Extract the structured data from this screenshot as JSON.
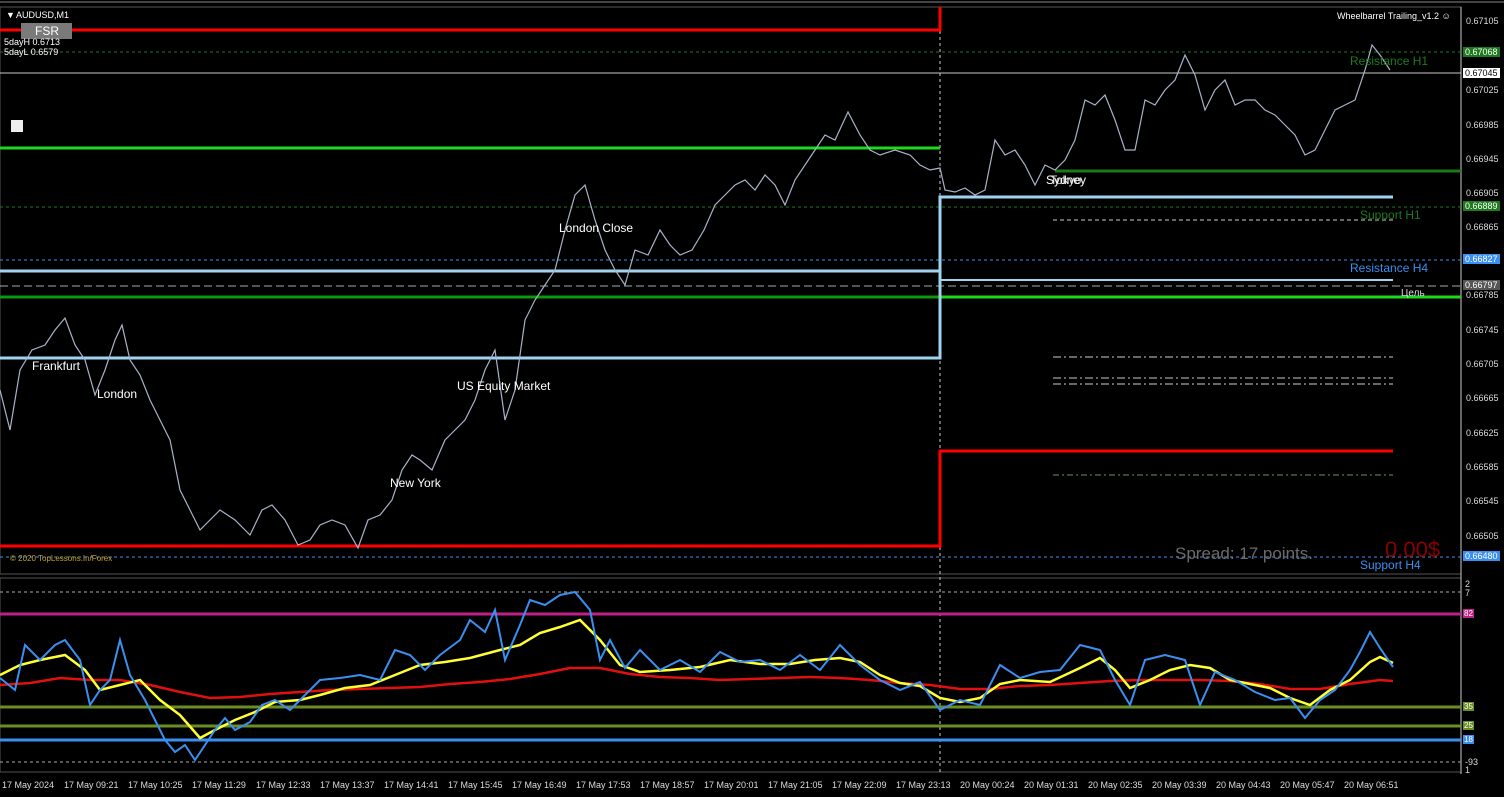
{
  "header": {
    "symbol": "AUDUSD,M1",
    "fsr_button": "FSR",
    "five_day_high": "5dayH 0.6713",
    "five_day_low": "5dayL 0.6579",
    "indicator_name": "Wheelbarrel Trailing_v1.2 ☺"
  },
  "sessions": {
    "frankfurt": "Frankfurt",
    "london": "London",
    "us_equity": "US Equity Market",
    "new_york": "New York",
    "london_close": "London Close",
    "sydney": "Sydney",
    "tokyo": "Tokyo"
  },
  "levels": {
    "resistance_h1": "Resistance H1",
    "support_h1": "Support H1",
    "resistance_h4": "Resistance H4",
    "support_h4": "Support H4",
    "target": "Цель"
  },
  "price_axis": [
    "0.67105",
    "0.67065",
    "0.67045",
    "0.67025",
    "0.66985",
    "0.66945",
    "0.66905",
    "0.66865",
    "0.66825",
    "0.66785",
    "0.66745",
    "0.66705",
    "0.66665",
    "0.66625",
    "0.66585",
    "0.66545",
    "0.66505"
  ],
  "price_tags": {
    "res_h1": "0.67068",
    "current": "0.67045",
    "sup_h1": "0.66889",
    "res_h4": "0.66827",
    "mid": "0.66797",
    "low": "0.66480"
  },
  "spread": "Spread: 17 points.",
  "profit": "0.00$",
  "copyright": "© 2020 TopLessons.In/Forex",
  "oscillator": {
    "axis_top": "2",
    "axis_top2": "7",
    "level_82": "82",
    "level_35": "35",
    "level_25": "25",
    "level_18": "18",
    "axis_bottom": "-93",
    "axis_bottom2": "1"
  },
  "time_axis": [
    "17 May 2024",
    "17 May 09:21",
    "17 May 10:25",
    "17 May 11:29",
    "17 May 12:33",
    "17 May 13:37",
    "17 May 14:41",
    "17 May 15:45",
    "17 May 16:49",
    "17 May 17:53",
    "17 May 18:57",
    "17 May 20:01",
    "17 May 21:05",
    "17 May 22:09",
    "17 May 23:13",
    "20 May 00:24",
    "20 May 01:31",
    "20 May 02:35",
    "20 May 03:39",
    "20 May 04:43",
    "20 May 05:47",
    "20 May 06:51"
  ],
  "colors": {
    "background": "#000000",
    "price_line": "#a8b2c8",
    "red_level": "#ff0000",
    "green_level": "#1ed81e",
    "light_blue_level": "#9fd3f0",
    "osc_blue": "#3a8ff0",
    "osc_yellow": "#ffff33",
    "osc_red": "#e01010",
    "magenta": "#c0208a",
    "olive": "#6b8e23"
  },
  "icons": [
    "dropdown-triangle-icon",
    "smiley-icon"
  ]
}
